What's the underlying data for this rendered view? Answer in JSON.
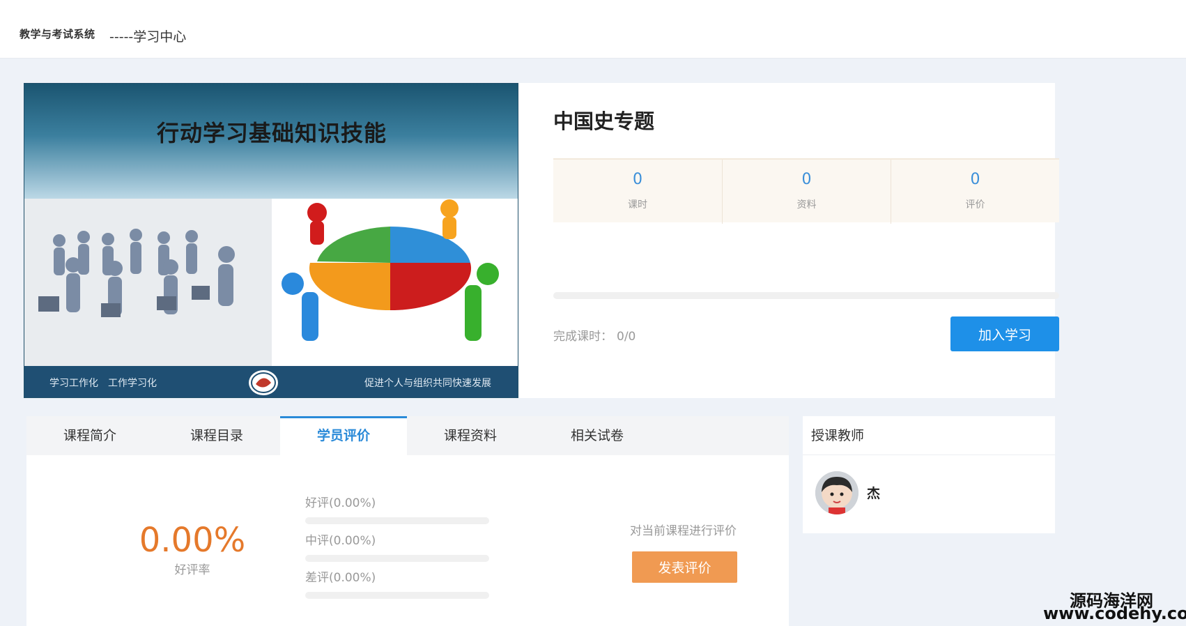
{
  "header": {
    "logo_text": "教学与考试系统",
    "section_title": "-----学习中心"
  },
  "course": {
    "cover": {
      "title": "行动学习基础知识技能",
      "slogan_left": "学习工作化　工作学习化",
      "slogan_right": "促进个人与组织共同快速发展"
    },
    "name": "中国史专题",
    "stats": [
      {
        "value": "0",
        "label": "课时"
      },
      {
        "value": "0",
        "label": "资料"
      },
      {
        "value": "0",
        "label": "评价"
      }
    ],
    "progress_fraction": 0,
    "done_label": "完成课时：",
    "done_value": "0/0",
    "join_label": "加入学习",
    "colors": {
      "primary": "#1e90e8",
      "accent_orange": "#e5792b"
    }
  },
  "tabs": [
    {
      "label": "课程简介",
      "active": false
    },
    {
      "label": "课程目录",
      "active": false
    },
    {
      "label": "学员评价",
      "active": true
    },
    {
      "label": "课程资料",
      "active": false
    },
    {
      "label": "相关试卷",
      "active": false
    }
  ],
  "review": {
    "rate": "0.00%",
    "rate_label": "好评率",
    "bars": [
      {
        "label": "好评(0.00%)",
        "fraction": 0
      },
      {
        "label": "中评(0.00%)",
        "fraction": 0
      },
      {
        "label": "差评(0.00%)",
        "fraction": 0
      }
    ],
    "prompt": "对当前课程进行评价",
    "button": "发表评价"
  },
  "teacher": {
    "heading": "授课教师",
    "name": "杰"
  },
  "watermark": {
    "line1": "源码海洋网",
    "line2": "www.codehy.com"
  }
}
